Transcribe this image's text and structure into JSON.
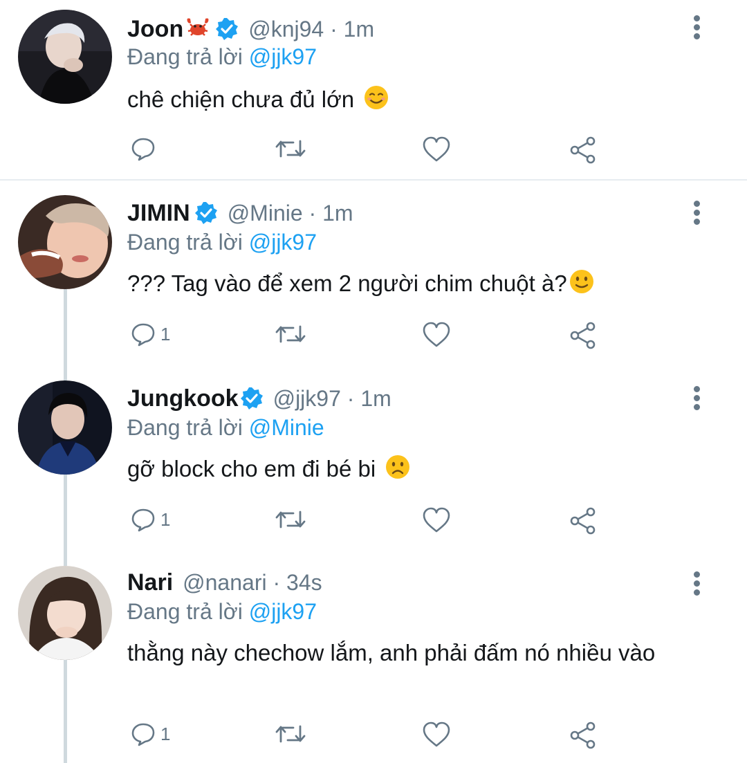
{
  "colors": {
    "accent": "#1da1f2",
    "secondary": "#657786",
    "text": "#14171a",
    "divider": "#e6ecf0",
    "thread": "#cfd9de"
  },
  "tweets": [
    {
      "name": "Joon",
      "name_emoji": "crab-emoji",
      "verified": true,
      "handle_time": "@knj94 · 1m",
      "reply_prefix": "Đang trả lời ",
      "reply_to": "@jjk97",
      "text": "chê chiện chưa đủ lớn",
      "text_emoji": "smiling-face-emoji",
      "reply_count": "",
      "avatar": "avatar-joon"
    },
    {
      "name": "JIMIN",
      "verified": true,
      "handle_time": "@Minie · 1m",
      "reply_prefix": "Đang trả lời ",
      "reply_to": "@jjk97",
      "text": "??? Tag vào để xem 2 người chim chuột à?",
      "text_emoji": "slightly-smiling-face-emoji",
      "reply_count": "1",
      "avatar": "avatar-jimin"
    },
    {
      "name": "Jungkook",
      "verified": true,
      "handle_time": "@jjk97 · 1m",
      "reply_prefix": "Đang trả lời ",
      "reply_to": "@Minie",
      "text": "gỡ block cho em đi bé bi",
      "text_emoji": "frowning-face-emoji",
      "reply_count": "1",
      "avatar": "avatar-jungkook"
    },
    {
      "name": "Nari",
      "verified": false,
      "handle_time": "@nanari · 34s",
      "reply_prefix": "Đang trả lời ",
      "reply_to": "@jjk97",
      "text": "thằng này chechow lắm, anh phải đấm nó nhiều vào",
      "reply_count": "1",
      "avatar": "avatar-nari"
    }
  ],
  "icons": {
    "reply": "reply-icon",
    "retweet": "retweet-icon",
    "like": "like-icon",
    "share": "share-icon",
    "more": "more-vertical-icon"
  }
}
